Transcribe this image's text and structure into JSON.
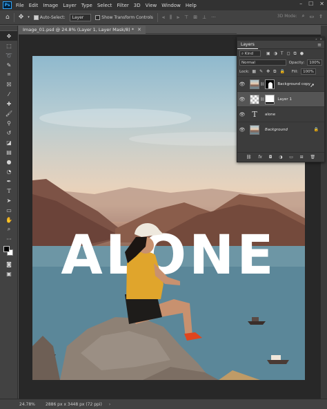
{
  "app": {
    "logo": "Ps"
  },
  "menu": [
    "File",
    "Edit",
    "Image",
    "Layer",
    "Type",
    "Select",
    "Filter",
    "3D",
    "View",
    "Window",
    "Help"
  ],
  "window_controls": {
    "minimize": "–",
    "maximize": "☐",
    "close": "✕"
  },
  "options": {
    "auto_select_label": "Auto-Select:",
    "auto_select_target": "Layer",
    "show_transform_label": "Show Transform Controls",
    "mode_3d": "3D Mode:"
  },
  "document": {
    "tab_title": "Image_01.psd @ 24.8% (Layer 1, Layer Mask/8) *",
    "close_glyph": "✕",
    "headline": "ALONE"
  },
  "status": {
    "zoom": "24.78%",
    "doc_info": "2886 px x 3448 px (72 ppi)",
    "arrow": "›"
  },
  "layers_panel": {
    "tab_label": "Layers",
    "kind_label": "Kind",
    "blend_mode": "Normal",
    "opacity_label": "Opacity:",
    "opacity_value": "100%",
    "lock_label": "Lock:",
    "fill_label": "Fill:",
    "fill_value": "100%",
    "layers": [
      {
        "name": "Background copy",
        "type": "photo-mask",
        "visible": true,
        "selected": false
      },
      {
        "name": "Layer 1",
        "type": "empty-mask",
        "visible": true,
        "selected": true
      },
      {
        "name": "alone",
        "type": "text",
        "visible": true,
        "selected": false
      },
      {
        "name": "Background",
        "type": "photo",
        "visible": true,
        "selected": false,
        "locked": true
      }
    ],
    "footer_icons": [
      "link-icon",
      "fx-icon",
      "mask-icon",
      "adjustment-icon",
      "group-icon",
      "new-layer-icon",
      "trash-icon"
    ]
  },
  "colors": {
    "foreground": "#000000",
    "background": "#ffffff",
    "accent": "#31a8ff"
  }
}
